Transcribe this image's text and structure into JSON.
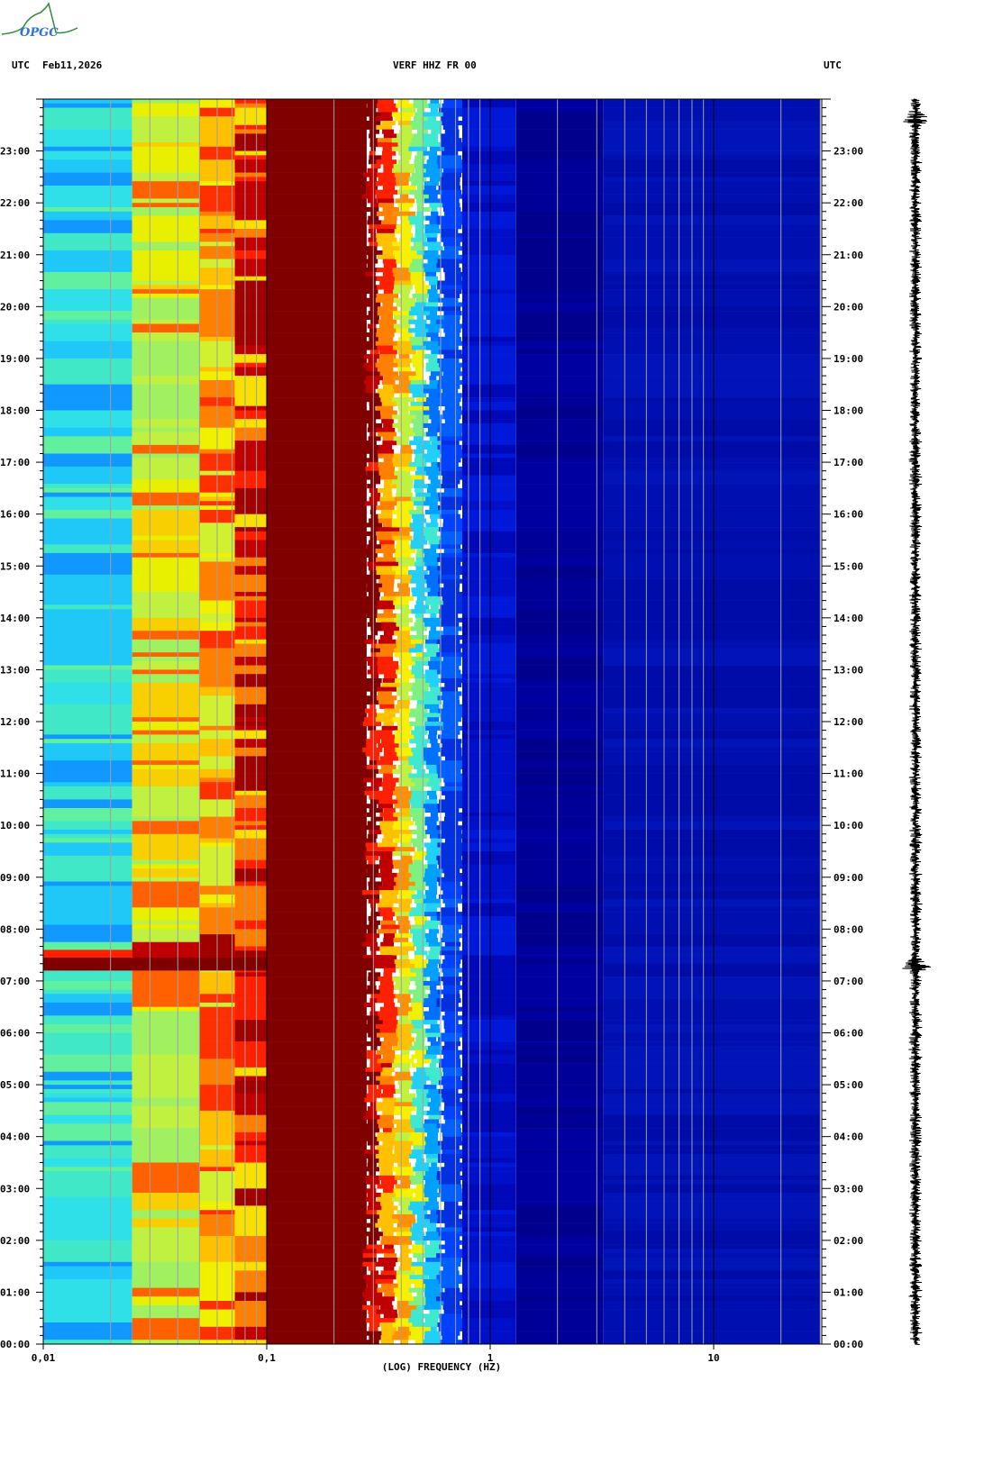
{
  "logo_text": "OPGC",
  "header": {
    "left_tz": "UTC",
    "date": "Feb11,2026",
    "station": "VERF HHZ FR 00",
    "right_tz": "UTC"
  },
  "chart_data": {
    "type": "heatmap",
    "title": "VERF HHZ FR 00",
    "xlabel": "(LOG) FREQUENCY (HZ)",
    "ylabel": "UTC",
    "xscale": "log",
    "xlim": [
      0.01,
      30
    ],
    "ylim_hours": [
      0,
      24
    ],
    "x_tick_labels": [
      {
        "value": 0.01,
        "label": "0,01"
      },
      {
        "value": 0.1,
        "label": "0,1"
      },
      {
        "value": 1,
        "label": "1"
      },
      {
        "value": 10,
        "label": "10"
      }
    ],
    "y_tick_labels": [
      "00:00",
      "01:00",
      "02:00",
      "03:00",
      "04:00",
      "05:00",
      "06:00",
      "07:00",
      "08:00",
      "09:00",
      "10:00",
      "11:00",
      "12:00",
      "13:00",
      "14:00",
      "15:00",
      "16:00",
      "17:00",
      "18:00",
      "19:00",
      "20:00",
      "21:00",
      "22:00",
      "23:00"
    ],
    "minor_tick_minutes": 10,
    "grid": "vertical log grid lines",
    "bands": [
      {
        "f": [
          0.01,
          0.025
        ],
        "palette": [
          "#30e0e8",
          "#20c8f8",
          "#60f0a0",
          "#40e8c8",
          "#1098ff"
        ]
      },
      {
        "f": [
          0.025,
          0.05
        ],
        "palette": [
          "#a0f060",
          "#e8f000",
          "#c0f040",
          "#f8d000",
          "#ff6000"
        ]
      },
      {
        "f": [
          0.05,
          0.072
        ],
        "palette": [
          "#f0f000",
          "#ffc000",
          "#d0f030",
          "#ff8000",
          "#ff3000"
        ]
      },
      {
        "f": [
          0.072,
          0.1
        ],
        "palette": [
          "#c00000",
          "#ff2000",
          "#a00000",
          "#ff8000",
          "#f8e000"
        ]
      },
      {
        "f": [
          0.1,
          0.28
        ],
        "palette": [
          "#800000"
        ]
      },
      {
        "f": [
          0.28,
          0.32
        ],
        "palette": [
          "#800000",
          "#c00000",
          "#ff2000",
          "#800000"
        ]
      },
      {
        "f": [
          0.32,
          0.38
        ],
        "palette": [
          "#ff2000",
          "#ff8000",
          "#ffc000",
          "#c00000"
        ]
      },
      {
        "f": [
          0.38,
          0.45
        ],
        "palette": [
          "#f8f000",
          "#ffc000",
          "#c0f040",
          "#ff9000"
        ]
      },
      {
        "f": [
          0.45,
          0.52
        ],
        "palette": [
          "#80f080",
          "#40e8d0",
          "#f0f000",
          "#20d0f8"
        ]
      },
      {
        "f": [
          0.52,
          0.6
        ],
        "palette": [
          "#00a0ff",
          "#20d0f8",
          "#0070ff",
          "#40e8d0"
        ]
      },
      {
        "f": [
          0.6,
          0.75
        ],
        "palette": [
          "#0040ff",
          "#0060ff",
          "#0030e0"
        ]
      },
      {
        "f": [
          0.75,
          1.3
        ],
        "palette": [
          "#0010c8",
          "#0018d8",
          "#0008b8"
        ]
      },
      {
        "f": [
          1.3,
          3.2
        ],
        "palette": [
          "#000098",
          "#0000a0",
          "#00008c"
        ]
      },
      {
        "f": [
          3.2,
          30
        ],
        "palette": [
          "#0010b0",
          "#0014b8",
          "#000ca8"
        ]
      }
    ],
    "events": [
      {
        "hours": [
          7.2,
          7.45
        ],
        "f": [
          0.01,
          0.3
        ],
        "color": "#800000"
      },
      {
        "hours": [
          7.45,
          7.6
        ],
        "f": [
          0.01,
          0.025
        ],
        "color": "#ff2000"
      },
      {
        "hours": [
          7.45,
          7.75
        ],
        "f": [
          0.025,
          0.05
        ],
        "color": "#c00000"
      },
      {
        "hours": [
          7.45,
          7.9
        ],
        "f": [
          0.05,
          0.072
        ],
        "color": "#a00000"
      }
    ],
    "trace_bursts_hours": [
      7.3,
      23.6
    ]
  }
}
